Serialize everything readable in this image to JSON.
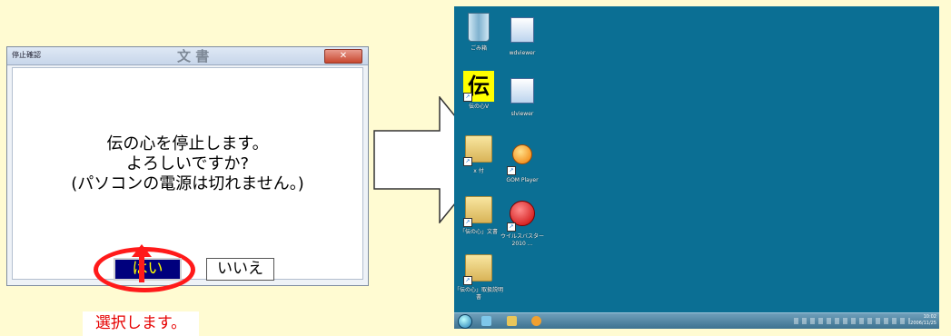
{
  "dialog": {
    "title": "停止確認",
    "background_word": "文 書",
    "close_label": "✕",
    "message_lines": [
      "伝の心を停止します。",
      "よろしいですか?",
      "(パソコンの電源は切れません。)"
    ],
    "yes_label": "はい",
    "no_label": "いいえ"
  },
  "caption": "選択します。",
  "colors": {
    "page_background": "#fffbd2",
    "highlight": "#ff1a1a",
    "yes_button_bg": "#00007d",
    "yes_button_text": "#ffff00",
    "desktop_background": "#0b6f94"
  },
  "desktop": {
    "icons": [
      {
        "label": "ごみ箱",
        "icon": "recycle-bin-icon"
      },
      {
        "label": "wdviewer",
        "icon": "app-icon"
      },
      {
        "label": "伝の心V",
        "icon": "den-no-kokoro-icon",
        "glyph": "伝"
      },
      {
        "label": "slviewer",
        "icon": "app-icon"
      },
      {
        "label": "x 付",
        "icon": "folder-icon"
      },
      {
        "label": "GOM Player",
        "icon": "gom-player-icon"
      },
      {
        "label": "「伝の心」文書",
        "icon": "folder-icon"
      },
      {
        "label": "ウイルスバスター2010 ...",
        "icon": "virus-buster-icon"
      },
      {
        "label": "「伝の心」取扱説明書",
        "icon": "folder-icon"
      }
    ],
    "taskbar": {
      "clock_time": "10:02",
      "clock_date": "2006/11/25"
    }
  }
}
